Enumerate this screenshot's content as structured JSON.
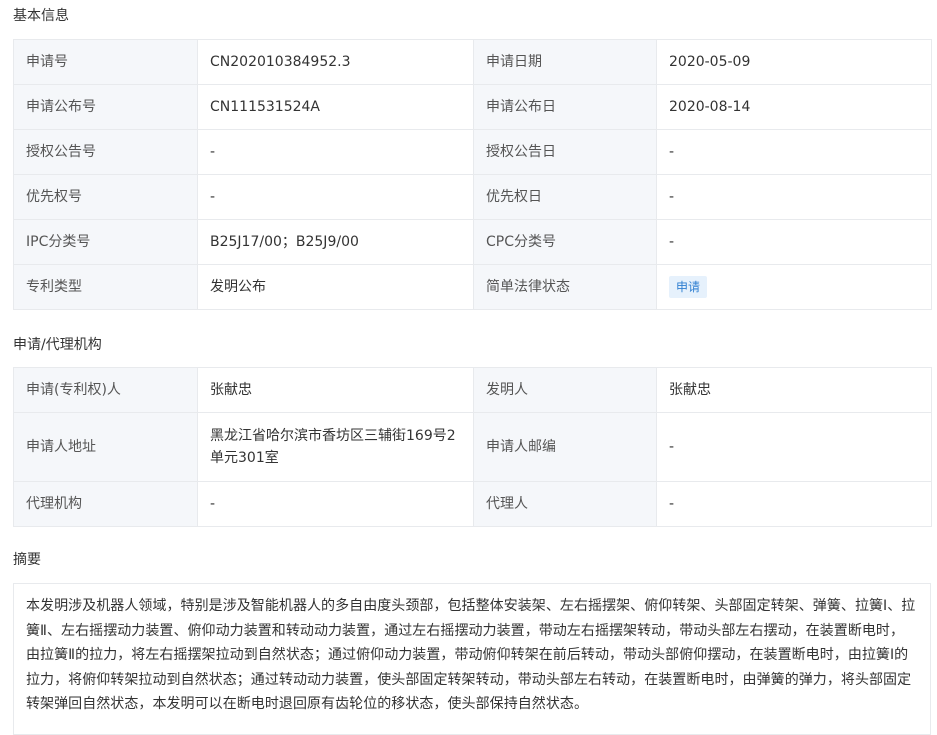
{
  "sections": {
    "basic": "基本信息",
    "agency": "申请/代理机构",
    "abstract": "摘要"
  },
  "basic_rows": [
    {
      "label1": "申请号",
      "value1": "CN202010384952.3",
      "label2": "申请日期",
      "value2": "2020-05-09"
    },
    {
      "label1": "申请公布号",
      "value1": "CN111531524A",
      "label2": "申请公布日",
      "value2": "2020-08-14"
    },
    {
      "label1": "授权公告号",
      "value1": "-",
      "label2": "授权公告日",
      "value2": "-"
    },
    {
      "label1": "优先权号",
      "value1": "-",
      "label2": "优先权日",
      "value2": "-"
    },
    {
      "label1": "IPC分类号",
      "value1": "B25J17/00；B25J9/00",
      "label2": "CPC分类号",
      "value2": "-"
    },
    {
      "label1": "专利类型",
      "value1": "发明公布",
      "label2": "简单法律状态",
      "value2": "申请"
    }
  ],
  "agency_rows": [
    {
      "label1": "申请(专利权)人",
      "value1": "张献忠",
      "label2": "发明人",
      "value2": "张献忠"
    },
    {
      "label1": "申请人地址",
      "value1": "黑龙江省哈尔滨市香坊区三辅街169号2单元301室",
      "label2": "申请人邮编",
      "value2": "-"
    },
    {
      "label1": "代理机构",
      "value1": "-",
      "label2": "代理人",
      "value2": "-"
    }
  ],
  "abstract_text": "本发明涉及机器人领域，特别是涉及智能机器人的多自由度头颈部，包括整体安装架、左右摇摆架、俯仰转架、头部固定转架、弹簧、拉簧Ⅰ、拉簧Ⅱ、左右摇摆动力装置、俯仰动力装置和转动动力装置，通过左右摇摆动力装置，带动左右摇摆架转动，带动头部左右摆动，在装置断电时，由拉簧Ⅱ的拉力，将左右摇摆架拉动到自然状态；通过俯仰动力装置，带动俯仰转架在前后转动，带动头部俯仰摆动，在装置断电时，由拉簧Ⅰ的拉力，将俯仰转架拉动到自然状态；通过转动动力装置，使头部固定转架转动，带动头部左右转动，在装置断电时，由弹簧的弹力，将头部固定转架弹回自然状态，本发明可以在断电时退回原有齿轮位的移状态，使头部保持自然状态。",
  "colors": {
    "label_bg": "#f5f7fa",
    "border": "#e8eaed",
    "badge_bg": "#e6f1fc",
    "badge_text": "#2f7fd1"
  }
}
